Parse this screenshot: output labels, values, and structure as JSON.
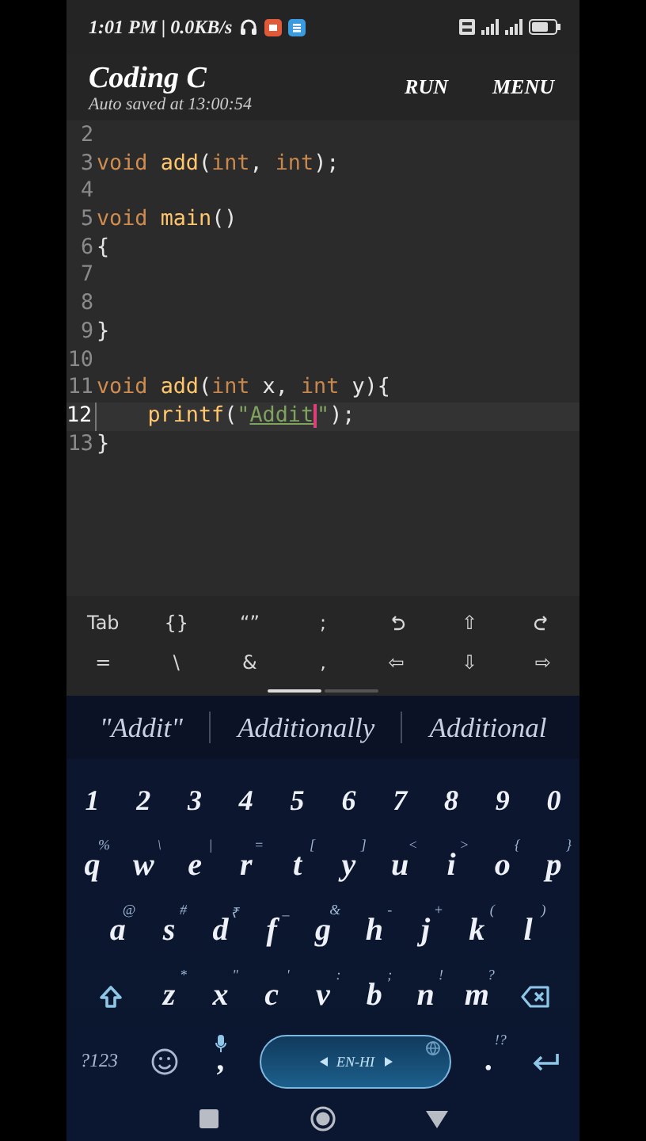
{
  "status_bar": {
    "text": "1:01 PM | 0.0KB/s"
  },
  "app_bar": {
    "title": "Coding C",
    "subtitle": "Auto saved at 13:00:54",
    "actions": [
      "RUN",
      "MENU"
    ]
  },
  "editor": {
    "lines": [
      {
        "number": "2",
        "selected": false
      },
      {
        "number": "3",
        "selected": false,
        "indented": false,
        "tokens": [
          {
            "kind": "keyword",
            "text": "void "
          },
          {
            "kind": "function",
            "text": "add"
          },
          {
            "kind": "plain",
            "text": "("
          },
          {
            "kind": "type",
            "text": "int"
          },
          {
            "kind": "plain",
            "text": ", "
          },
          {
            "kind": "type",
            "text": "int"
          },
          {
            "kind": "plain",
            "text": ");"
          }
        ]
      },
      {
        "number": "4",
        "selected": false
      },
      {
        "number": "5",
        "selected": false,
        "indented": false,
        "tokens": [
          {
            "kind": "keyword",
            "text": "void "
          },
          {
            "kind": "function",
            "text": "main"
          },
          {
            "kind": "plain",
            "text": "()"
          }
        ]
      },
      {
        "number": "6",
        "selected": false,
        "indented": false,
        "tokens": [
          {
            "kind": "plain",
            "text": "{"
          }
        ]
      },
      {
        "number": "7",
        "selected": false
      },
      {
        "number": "8",
        "selected": false
      },
      {
        "number": "9",
        "selected": false,
        "indented": false,
        "tokens": [
          {
            "kind": "plain",
            "text": "}"
          }
        ]
      },
      {
        "number": "10",
        "selected": false
      },
      {
        "number": "11",
        "selected": false,
        "indented": false,
        "tokens": [
          {
            "kind": "keyword",
            "text": "void "
          },
          {
            "kind": "function",
            "text": "add"
          },
          {
            "kind": "plain",
            "text": "("
          },
          {
            "kind": "type",
            "text": "int"
          },
          {
            "kind": "plain",
            "text": " x, "
          },
          {
            "kind": "type",
            "text": "int"
          },
          {
            "kind": "plain",
            "text": " y){"
          }
        ]
      },
      {
        "number": "12",
        "selected": true,
        "indented": true,
        "tokens": [
          {
            "kind": "function",
            "text": "printf"
          },
          {
            "kind": "plain",
            "text": "("
          },
          {
            "kind": "string",
            "text": "\""
          },
          {
            "kind": "composing",
            "text": "Addit"
          },
          {
            "kind": "caret"
          },
          {
            "kind": "string",
            "text": "\""
          },
          {
            "kind": "plain",
            "text": ");"
          }
        ]
      },
      {
        "number": "13",
        "selected": false,
        "indented": false,
        "tokens": [
          {
            "kind": "plain",
            "text": "}"
          }
        ]
      }
    ]
  },
  "extra_keys": [
    [
      {
        "kind": "text",
        "label": "Tab"
      },
      {
        "kind": "text",
        "label": "{}"
      },
      {
        "kind": "text",
        "label": "“”"
      },
      {
        "kind": "text",
        "label": ";"
      },
      {
        "kind": "undo"
      },
      {
        "kind": "text",
        "label": "⇧"
      },
      {
        "kind": "redo"
      }
    ],
    [
      {
        "kind": "text",
        "label": "="
      },
      {
        "kind": "text",
        "label": "\\"
      },
      {
        "kind": "text",
        "label": "&"
      },
      {
        "kind": "text",
        "label": ","
      },
      {
        "kind": "text",
        "label": "⇦"
      },
      {
        "kind": "text",
        "label": "⇩"
      },
      {
        "kind": "text",
        "label": "⇨"
      }
    ]
  ],
  "suggestions": [
    "\"Addit\"",
    "Additionally",
    "Additional"
  ],
  "keyboard": {
    "number_row": [
      "1",
      "2",
      "3",
      "4",
      "5",
      "6",
      "7",
      "8",
      "9",
      "0"
    ],
    "rows": [
      [
        {
          "kind": "key",
          "key": "q",
          "hint": "%"
        },
        {
          "kind": "key",
          "key": "w",
          "hint": "\\"
        },
        {
          "kind": "key",
          "key": "e",
          "hint": "|"
        },
        {
          "kind": "key",
          "key": "r",
          "hint": "="
        },
        {
          "kind": "key",
          "key": "t",
          "hint": "["
        },
        {
          "kind": "key",
          "key": "y",
          "hint": "]"
        },
        {
          "kind": "key",
          "key": "u",
          "hint": "<"
        },
        {
          "kind": "key",
          "key": "i",
          "hint": ">"
        },
        {
          "kind": "key",
          "key": "o",
          "hint": "{"
        },
        {
          "kind": "key",
          "key": "p",
          "hint": "}"
        }
      ],
      [
        {
          "kind": "key",
          "key": "a",
          "hint": "@"
        },
        {
          "kind": "key",
          "key": "s",
          "hint": "#"
        },
        {
          "kind": "key",
          "key": "d",
          "hint": "₹"
        },
        {
          "kind": "key",
          "key": "f",
          "hint": "_"
        },
        {
          "kind": "key",
          "key": "g",
          "hint": "&"
        },
        {
          "kind": "key",
          "key": "h",
          "hint": "-"
        },
        {
          "kind": "key",
          "key": "j",
          "hint": "+"
        },
        {
          "kind": "key",
          "key": "k",
          "hint": "("
        },
        {
          "kind": "key",
          "key": "l",
          "hint": ")"
        }
      ],
      [
        {
          "kind": "shift"
        },
        {
          "kind": "key",
          "key": "z",
          "hint": "*"
        },
        {
          "kind": "key",
          "key": "x",
          "hint": "\""
        },
        {
          "kind": "key",
          "key": "c",
          "hint": "'"
        },
        {
          "kind": "key",
          "key": "v",
          "hint": ":"
        },
        {
          "kind": "key",
          "key": "b",
          "hint": ";"
        },
        {
          "kind": "key",
          "key": "n",
          "hint": "!"
        },
        {
          "kind": "key",
          "key": "m",
          "hint": "?"
        },
        {
          "kind": "backspace"
        }
      ],
      [
        {
          "kind": "symbols",
          "label": "?123"
        },
        {
          "kind": "emoji"
        },
        {
          "kind": "mic-key",
          "key": ","
        },
        {
          "kind": "space",
          "label": "EN-HI"
        },
        {
          "kind": "key",
          "key": ".",
          "hint": "!?"
        },
        {
          "kind": "enter"
        }
      ]
    ]
  }
}
